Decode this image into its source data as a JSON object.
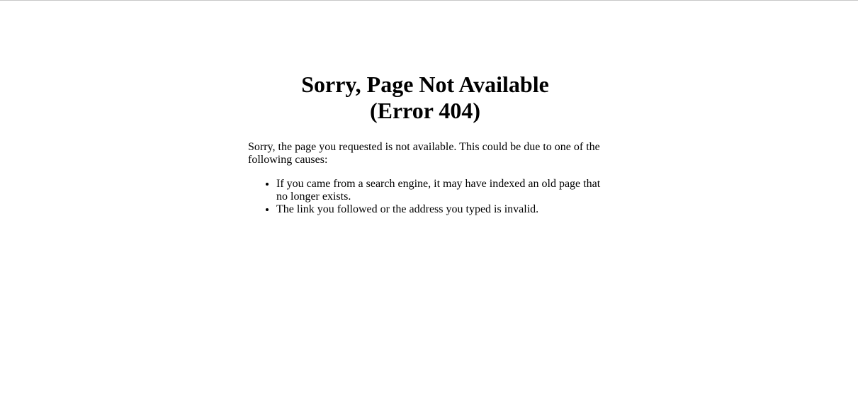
{
  "error_page": {
    "title_line1": "Sorry, Page Not Available",
    "title_line2": "(Error 404)",
    "intro": "Sorry, the page you requested is not available. This could be due to one of the following causes:",
    "causes": [
      "If you came from a search engine, it may have indexed an old page that no longer exists.",
      "The link you followed or the address you typed is invalid."
    ]
  }
}
